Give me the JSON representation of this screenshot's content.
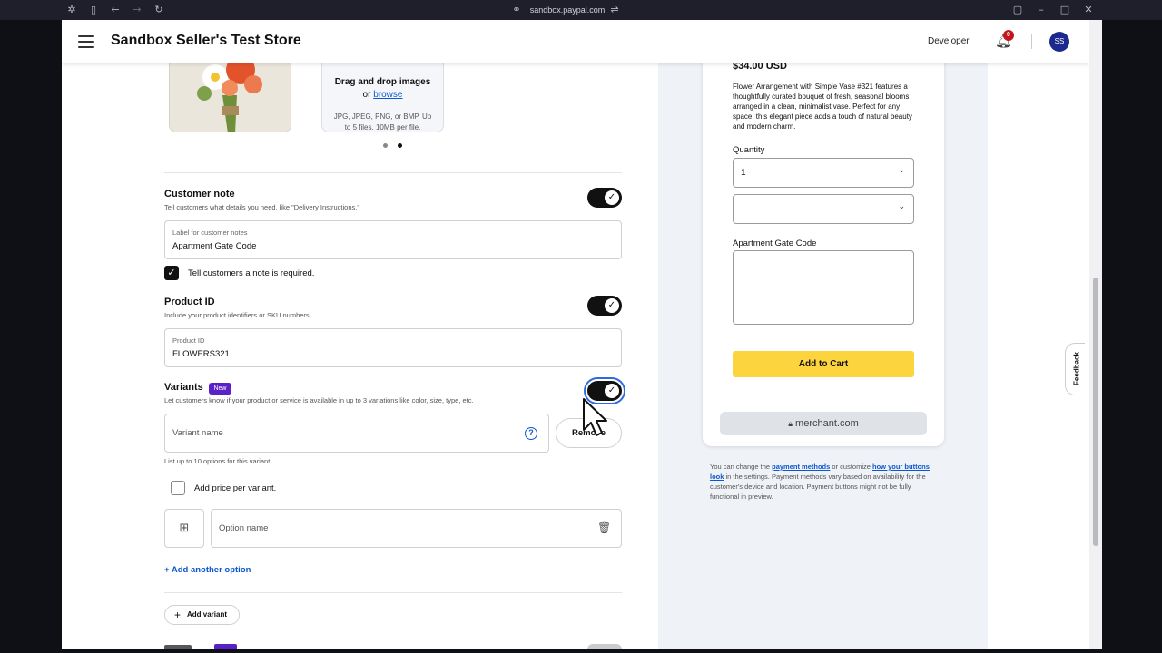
{
  "browser": {
    "url": "sandbox.paypal.com"
  },
  "header": {
    "store_title": "Sandbox Seller's Test Store",
    "developer_label": "Developer",
    "notification_count": "0",
    "avatar_initials": "SS"
  },
  "image_upload": {
    "drag_text": "Drag and drop images",
    "or_text": "or",
    "browse_link": "browse",
    "hint": "JPG, JPEG, PNG, or BMP. Up to 5 files. 10MB per file."
  },
  "customer_note": {
    "title": "Customer note",
    "description": "Tell customers what details you need, like \"Delivery Instructions.\"",
    "field_label": "Label for customer notes",
    "field_value": "Apartment Gate Code",
    "required_checkbox_label": "Tell customers a note is required.",
    "enabled": true,
    "required": true
  },
  "product_id": {
    "title": "Product ID",
    "description": "Include your product identifiers or SKU numbers.",
    "field_label": "Product ID",
    "field_value": "FLOWERS321",
    "enabled": true
  },
  "variants": {
    "title": "Variants",
    "badge": "New",
    "description": "Let customers know if your product or service is available in up to 3 variations like color, size, type, etc.",
    "variant_name_placeholder": "Variant name",
    "remove_label": "Remove",
    "options_note": "List up to 10 options for this variant.",
    "price_per_variant_label": "Add price per variant.",
    "option_name_placeholder": "Option name",
    "add_option_label": "+ Add another option",
    "add_variant_label": "Add variant",
    "enabled": true
  },
  "preview": {
    "price": "$34.00 USD",
    "description": "Flower Arrangement with Simple Vase #321 features a thoughtfully curated bouquet of fresh, seasonal blooms arranged in a clean, minimalist vase. Perfect for any space, this elegant piece adds a touch of natural beauty and modern charm.",
    "quantity_label": "Quantity",
    "quantity_value": "1",
    "variant_select_value": "",
    "note_label": "Apartment Gate Code",
    "add_to_cart": "Add to Cart",
    "merchant_domain": "merchant.com",
    "fine_print_1": "You can change the ",
    "payment_methods_link": "payment methods",
    "fine_print_2": " or customize ",
    "buttons_look_link": "how your buttons look",
    "fine_print_3": " in the settings. Payment methods vary based on availability for the customer's device and location. Payment buttons might not be fully functional in preview."
  },
  "feedback_label": "Feedback",
  "icons": {
    "menu": "hamburger-icon",
    "bell": "bell-icon",
    "help": "question-circle-icon",
    "image": "image-add-icon",
    "trash": "trash-icon",
    "lock": "lock-icon",
    "chevron": "chevron-down-icon"
  },
  "colors": {
    "accent_blue": "#0b57d0",
    "badge_purple": "#5a22c6",
    "cart_yellow": "#fcd43e",
    "avatar_navy": "#1b2a8c",
    "notification_red": "#c4161c"
  }
}
